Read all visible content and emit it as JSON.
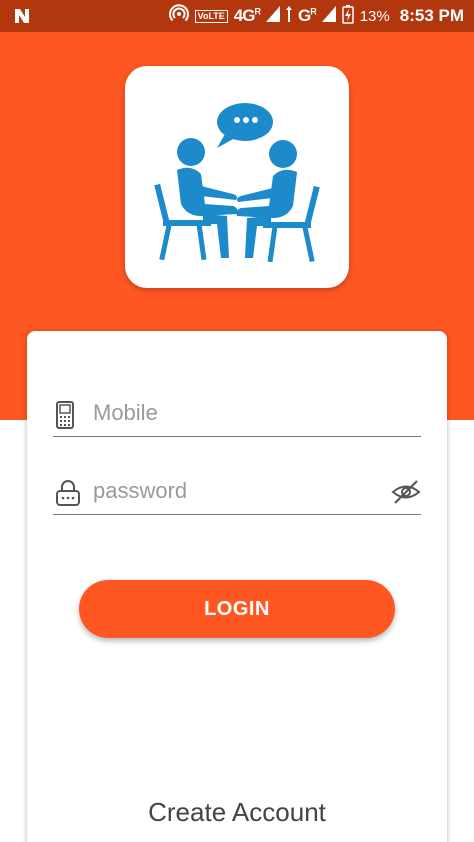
{
  "status_bar": {
    "volte": "VoLTE",
    "network_1": "4G",
    "network_roaming_1": "R",
    "network_2": "G",
    "network_roaming_2": "R",
    "battery_percent": "13%",
    "time": "8:53 PM"
  },
  "logo": {
    "icon": "two-people-talking-icon",
    "color": "#1C8ACB"
  },
  "form": {
    "mobile_placeholder": "Mobile",
    "mobile_value": "",
    "password_placeholder": "password",
    "password_value": "",
    "login_label": "LOGIN",
    "create_account_label": "Create Account"
  },
  "colors": {
    "status_bar": "#B2360E",
    "accent": "#FF5722"
  }
}
